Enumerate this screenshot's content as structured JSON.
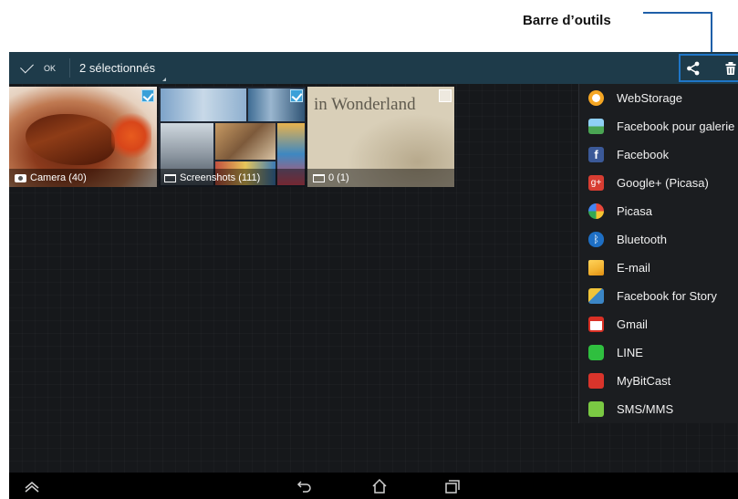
{
  "callout": {
    "label": "Barre d’outils"
  },
  "action_bar": {
    "ok_label": "OK",
    "selection_label": "2 sélectionnés",
    "share_icon": "share-icon",
    "delete_icon": "trash-icon",
    "background_color": "#1e3b4a",
    "accent_color": "#1f76c8"
  },
  "albums": [
    {
      "label": "Camera (40)",
      "icon": "camera-icon",
      "checked": true
    },
    {
      "label": "Screenshots (111)",
      "icon": "folder-icon",
      "checked": true
    },
    {
      "label": "0 (1)",
      "icon": "folder-icon",
      "checked": false,
      "thumbnail_text": "in Wonderland"
    }
  ],
  "share_menu": {
    "items": [
      {
        "label": "WebStorage",
        "icon": "webstorage-icon",
        "color": "#f5a623"
      },
      {
        "label": "Facebook pour galerie",
        "icon": "gallery-icon",
        "color": "#4fa3d9"
      },
      {
        "label": "Facebook",
        "icon": "facebook-icon",
        "color": "#3b5998"
      },
      {
        "label": "Google+ (Picasa)",
        "icon": "googleplus-icon",
        "color": "#d73d32"
      },
      {
        "label": "Picasa",
        "icon": "picasa-icon",
        "color": "#e8473b"
      },
      {
        "label": "Bluetooth",
        "icon": "bluetooth-icon",
        "color": "#1e6fc4"
      },
      {
        "label": "E-mail",
        "icon": "email-icon",
        "color": "#f2b231"
      },
      {
        "label": "Facebook for Story",
        "icon": "story-icon",
        "color": "#3b86c6"
      },
      {
        "label": "Gmail",
        "icon": "gmail-icon",
        "color": "#d93025"
      },
      {
        "label": "LINE",
        "icon": "line-icon",
        "color": "#2fbf3f"
      },
      {
        "label": "MyBitCast",
        "icon": "mybitcast-icon",
        "color": "#d9342b"
      },
      {
        "label": "SMS/MMS",
        "icon": "sms-icon",
        "color": "#7ac943"
      }
    ]
  },
  "nav_bar": {
    "buttons": [
      "up-chevron-icon",
      "back-icon",
      "home-icon",
      "recents-icon"
    ]
  }
}
